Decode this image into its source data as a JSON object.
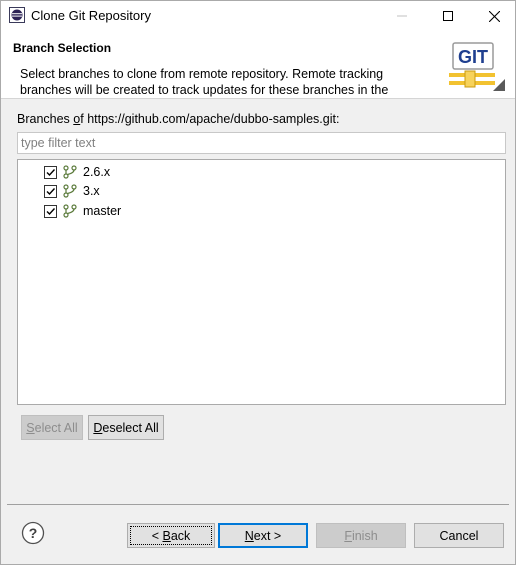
{
  "window": {
    "title": "Clone Git Repository"
  },
  "banner": {
    "title": "Branch Selection",
    "description": "Select branches to clone from remote repository. Remote tracking branches will be created to track updates for these branches in the",
    "logo_text": "GIT"
  },
  "branches": {
    "label_prefix": "Branches ",
    "label_mnemonic": "o",
    "label_mid": "f",
    "label_suffix": " https://github.com/apache/dubbo-samples.git:",
    "filter_placeholder": "type filter text",
    "items": [
      {
        "label": "2.6.x",
        "checked": true
      },
      {
        "label": "3.x",
        "checked": true
      },
      {
        "label": "master",
        "checked": true
      }
    ]
  },
  "buttons": {
    "select_all_mn": "S",
    "select_all_rest": "elect All",
    "deselect_all_mn": "D",
    "deselect_all_rest": "eselect All",
    "back_pre": "< ",
    "back_mn": "B",
    "back_rest": "ack",
    "next_mn": "N",
    "next_rest": "ext >",
    "finish_mn": "F",
    "finish_rest": "inish",
    "cancel": "Cancel"
  },
  "colors": {
    "focus": "#0078d7",
    "disabled_text": "#8d8d8d"
  }
}
